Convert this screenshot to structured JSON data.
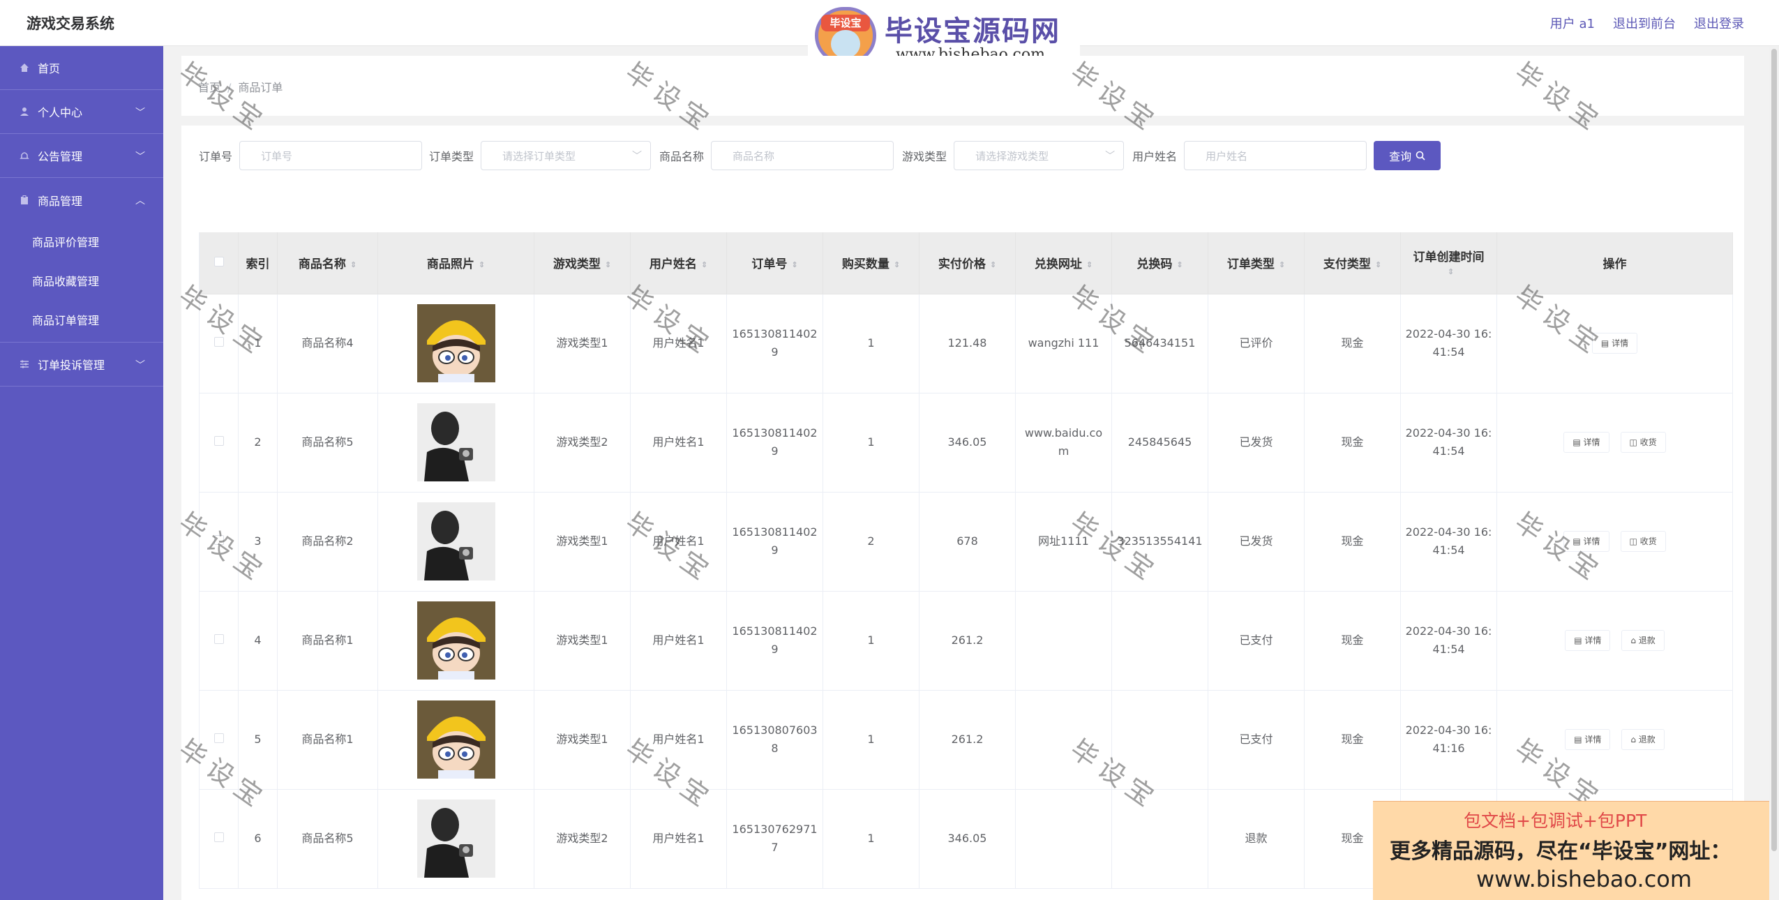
{
  "app_title": "游戏交易系统",
  "header_links": [
    "用户 a1",
    "退出到前台",
    "退出登录"
  ],
  "brand": {
    "badge": "毕设宝",
    "name": "毕设宝源码网",
    "url": "www.bishebao.com"
  },
  "sidebar": {
    "home": "首页",
    "personal": "个人中心",
    "notice": "公告管理",
    "goods": "商品管理",
    "goods_sub": [
      "商品评价管理",
      "商品收藏管理",
      "商品订单管理"
    ],
    "complaint": "订单投诉管理"
  },
  "breadcrumb": {
    "home": "首页",
    "sep": "/",
    "current": "商品订单"
  },
  "search": {
    "order_no_label": "订单号",
    "order_no_placeholder": "订单号",
    "order_type_label": "订单类型",
    "order_type_placeholder": "请选择订单类型",
    "goods_name_label": "商品名称",
    "goods_name_placeholder": "商品名称",
    "game_type_label": "游戏类型",
    "game_type_placeholder": "请选择游戏类型",
    "user_name_label": "用户姓名",
    "user_name_placeholder": "用户姓名",
    "query_button": "查询"
  },
  "table": {
    "headers": [
      "索引",
      "商品名称",
      "商品照片",
      "游戏类型",
      "用户姓名",
      "订单号",
      "购买数量",
      "实付价格",
      "兑换网址",
      "兑换码",
      "订单类型",
      "支付类型",
      "订单创建时间",
      "操作"
    ],
    "rows": [
      {
        "index": "1",
        "name": "商品名称4",
        "photo": "cartoon",
        "game": "游戏类型1",
        "user": "用户姓名1",
        "order": "1651308114029",
        "qty": "1",
        "price": "121.48",
        "url": "wangzhi 111",
        "code": "5646434151",
        "type": "已评价",
        "pay": "现金",
        "time": "2022-04-30 16:41:54",
        "ops": [
          "详情"
        ]
      },
      {
        "index": "2",
        "name": "商品名称5",
        "photo": "portrait",
        "game": "游戏类型2",
        "user": "用户姓名1",
        "order": "1651308114029",
        "qty": "1",
        "price": "346.05",
        "url": "www.baidu.com",
        "code": "245845645",
        "type": "已发货",
        "pay": "现金",
        "time": "2022-04-30 16:41:54",
        "ops": [
          "详情",
          "收货"
        ]
      },
      {
        "index": "3",
        "name": "商品名称2",
        "photo": "portrait",
        "game": "游戏类型1",
        "user": "用户姓名1",
        "order": "1651308114029",
        "qty": "2",
        "price": "678",
        "url": "网址1111",
        "code": "323513554141",
        "type": "已发货",
        "pay": "现金",
        "time": "2022-04-30 16:41:54",
        "ops": [
          "详情",
          "收货"
        ]
      },
      {
        "index": "4",
        "name": "商品名称1",
        "photo": "cartoon",
        "game": "游戏类型1",
        "user": "用户姓名1",
        "order": "1651308114029",
        "qty": "1",
        "price": "261.2",
        "url": "",
        "code": "",
        "type": "已支付",
        "pay": "现金",
        "time": "2022-04-30 16:41:54",
        "ops": [
          "详情",
          "退款"
        ]
      },
      {
        "index": "5",
        "name": "商品名称1",
        "photo": "cartoon",
        "game": "游戏类型1",
        "user": "用户姓名1",
        "order": "1651308076038",
        "qty": "1",
        "price": "261.2",
        "url": "",
        "code": "",
        "type": "已支付",
        "pay": "现金",
        "time": "2022-04-30 16:41:16",
        "ops": [
          "详情",
          "退款"
        ]
      },
      {
        "index": "6",
        "name": "商品名称5",
        "photo": "portrait",
        "game": "游戏类型2",
        "user": "用户姓名1",
        "order": "1651307629717",
        "qty": "1",
        "price": "346.05",
        "url": "",
        "code": "",
        "type": "退款",
        "pay": "现金",
        "time": "",
        "ops": []
      }
    ]
  },
  "watermark": "毕设宝",
  "ad": {
    "line1": "包文档+包调试+包PPT",
    "line2": "更多精品源码，尽在“毕设宝”网址：",
    "line3": "www.bishebao.com"
  },
  "colors": {
    "primary": "#5c58c0",
    "header_bg": "#ffffff",
    "ad_bg": "#ffd9a8",
    "ad_red": "#e04848"
  }
}
